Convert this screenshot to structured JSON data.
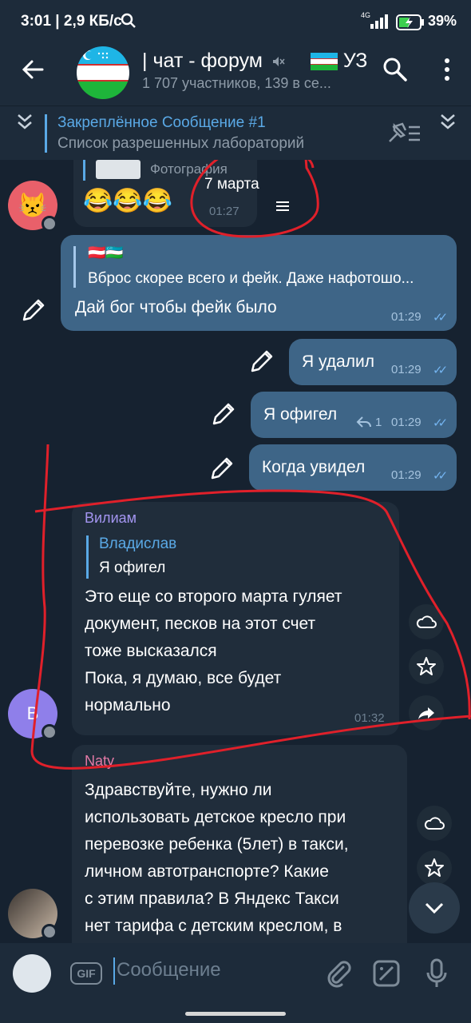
{
  "status": {
    "time": "3:01 | 2,9 КБ/с",
    "network": "4G",
    "battery": "39%"
  },
  "header": {
    "title": "| чат - форум",
    "title_suffix": "УЗ",
    "subtitle": "1 707 участников, 139 в се..."
  },
  "pinned": {
    "title": "Закреплённое Сообщение #1",
    "text": "Список разрешенных лабораторий"
  },
  "messages": {
    "m0": {
      "media_label": "Фотография",
      "date_overlay": "7 марта",
      "emojis": "😂😂😂",
      "time": "01:27"
    },
    "m1": {
      "reply_flags": "🇦🇹🇺🇿",
      "reply_text": "Вброс скорее всего и фейк. Даже нафотошо...",
      "text": "Дай бог чтобы фейк было",
      "time": "01:29"
    },
    "m2": {
      "text": "Я удалил",
      "time": "01:29"
    },
    "m3": {
      "text": "Я офигел",
      "reply_count": "1",
      "time": "01:29"
    },
    "m4": {
      "text": "Когда увидел",
      "time": "01:29"
    },
    "m5": {
      "author": "Вилиам",
      "reply_author": "Владислав",
      "reply_text": "Я офигел",
      "line1": "Это еще со второго марта гуляет",
      "line2": "документ, песков на этот счет",
      "line3": "тоже высказался",
      "line4": "Пока, я думаю, все будет",
      "line5": "нормально",
      "time": "01:32",
      "avatar_letter": "В"
    },
    "m6": {
      "author": "Naty",
      "line1": "Здравствуйте, нужно ли",
      "line2": "использовать детское кресло при",
      "line3": "перевозке ребенка (5лет) в такси,",
      "line4": "личном автотранспорте? Какие",
      "line5": "с этим правила? В Яндекс Такси",
      "line6": "нет тарифа с детским креслом, в"
    }
  },
  "input": {
    "gif_label": "GIF",
    "placeholder": "Сообщение"
  },
  "colors": {
    "accent": "#5aa9e6",
    "outgoing": "#3e6587",
    "incoming": "#202d3b",
    "annotation": "#e0202a"
  }
}
